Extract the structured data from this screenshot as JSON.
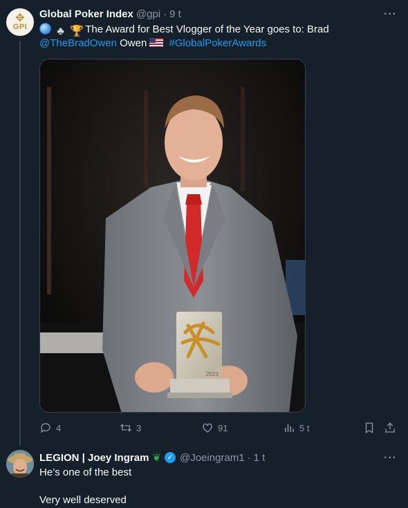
{
  "tweet": {
    "author_name": "Global Poker Index",
    "handle": "@gpi",
    "separator": "·",
    "time": "9 t",
    "avatar_text": "GPI",
    "text_main": "The Award for Best Vlogger of the Year goes to: Brad",
    "mention": "@TheBradOwen",
    "text_after_mention": "Owen",
    "hashtag": "#GlobalPokerAwards",
    "emojis": [
      "globe-icon",
      "club-icon",
      "trophy-icon",
      "us-flag-icon"
    ],
    "image_alt": "Man in grey suit and red tie holding a glass award trophy",
    "trophy_year": "2023"
  },
  "actions": {
    "replies": "4",
    "retweets": "3",
    "likes": "91",
    "views": "5 t"
  },
  "reply": {
    "author_name": "LEGION | Joey Ingram",
    "handle": "@Joeingram1",
    "separator": "·",
    "time": "1 t",
    "line1": "He’s one of the best",
    "line2": "Very well deserved"
  },
  "colors": {
    "background": "#15202b",
    "link": "#1d9bf0",
    "muted": "#8b98a5",
    "verified": "#1d9bf0"
  }
}
